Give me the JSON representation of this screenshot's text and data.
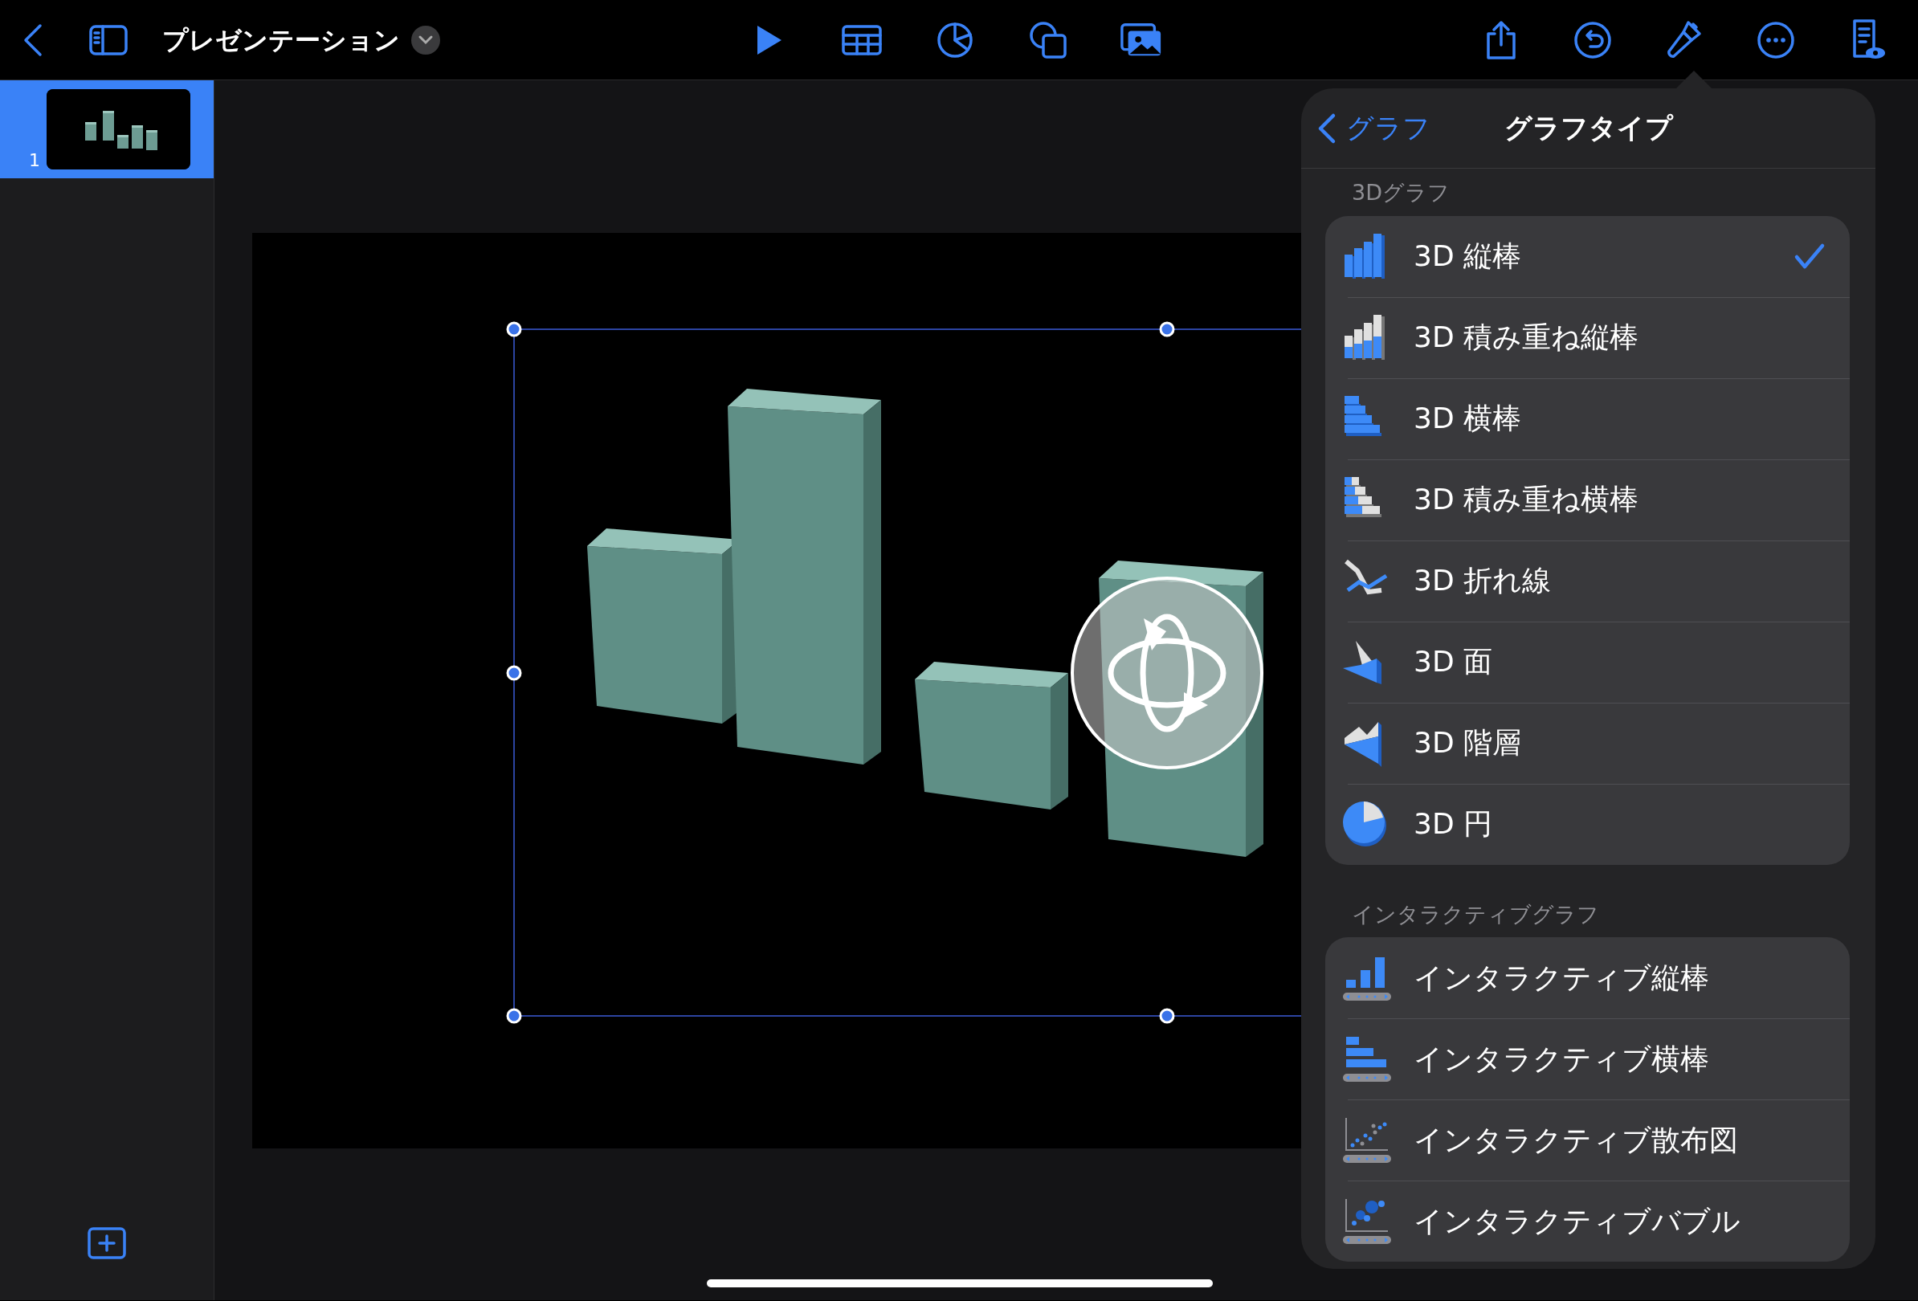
{
  "toolbar": {
    "title": "プレゼンテーション"
  },
  "slides": [
    {
      "number": "1",
      "selected": true
    }
  ],
  "popover": {
    "back": "グラフ",
    "title": "グラフタイプ",
    "sections": [
      {
        "header": "3Dグラフ",
        "items": [
          {
            "label": "3D 縦棒",
            "kind": "column3d",
            "selected": true
          },
          {
            "label": "3D 積み重ね縦棒",
            "kind": "stackedcolumn3d",
            "selected": false
          },
          {
            "label": "3D 横棒",
            "kind": "bar3d",
            "selected": false
          },
          {
            "label": "3D 積み重ね横棒",
            "kind": "stackedbar3d",
            "selected": false
          },
          {
            "label": "3D 折れ線",
            "kind": "line3d",
            "selected": false
          },
          {
            "label": "3D 面",
            "kind": "area3d",
            "selected": false
          },
          {
            "label": "3D 階層",
            "kind": "stackedarea3d",
            "selected": false
          },
          {
            "label": "3D 円",
            "kind": "pie3d",
            "selected": false
          }
        ]
      },
      {
        "header": "インタラクティブグラフ",
        "items": [
          {
            "label": "インタラクティブ縦棒",
            "kind": "icolumn",
            "selected": false
          },
          {
            "label": "インタラクティブ横棒",
            "kind": "ibar",
            "selected": false
          },
          {
            "label": "インタラクティブ散布図",
            "kind": "iscatter",
            "selected": false
          },
          {
            "label": "インタラクティブバブル",
            "kind": "ibubble",
            "selected": false
          }
        ]
      }
    ]
  }
}
